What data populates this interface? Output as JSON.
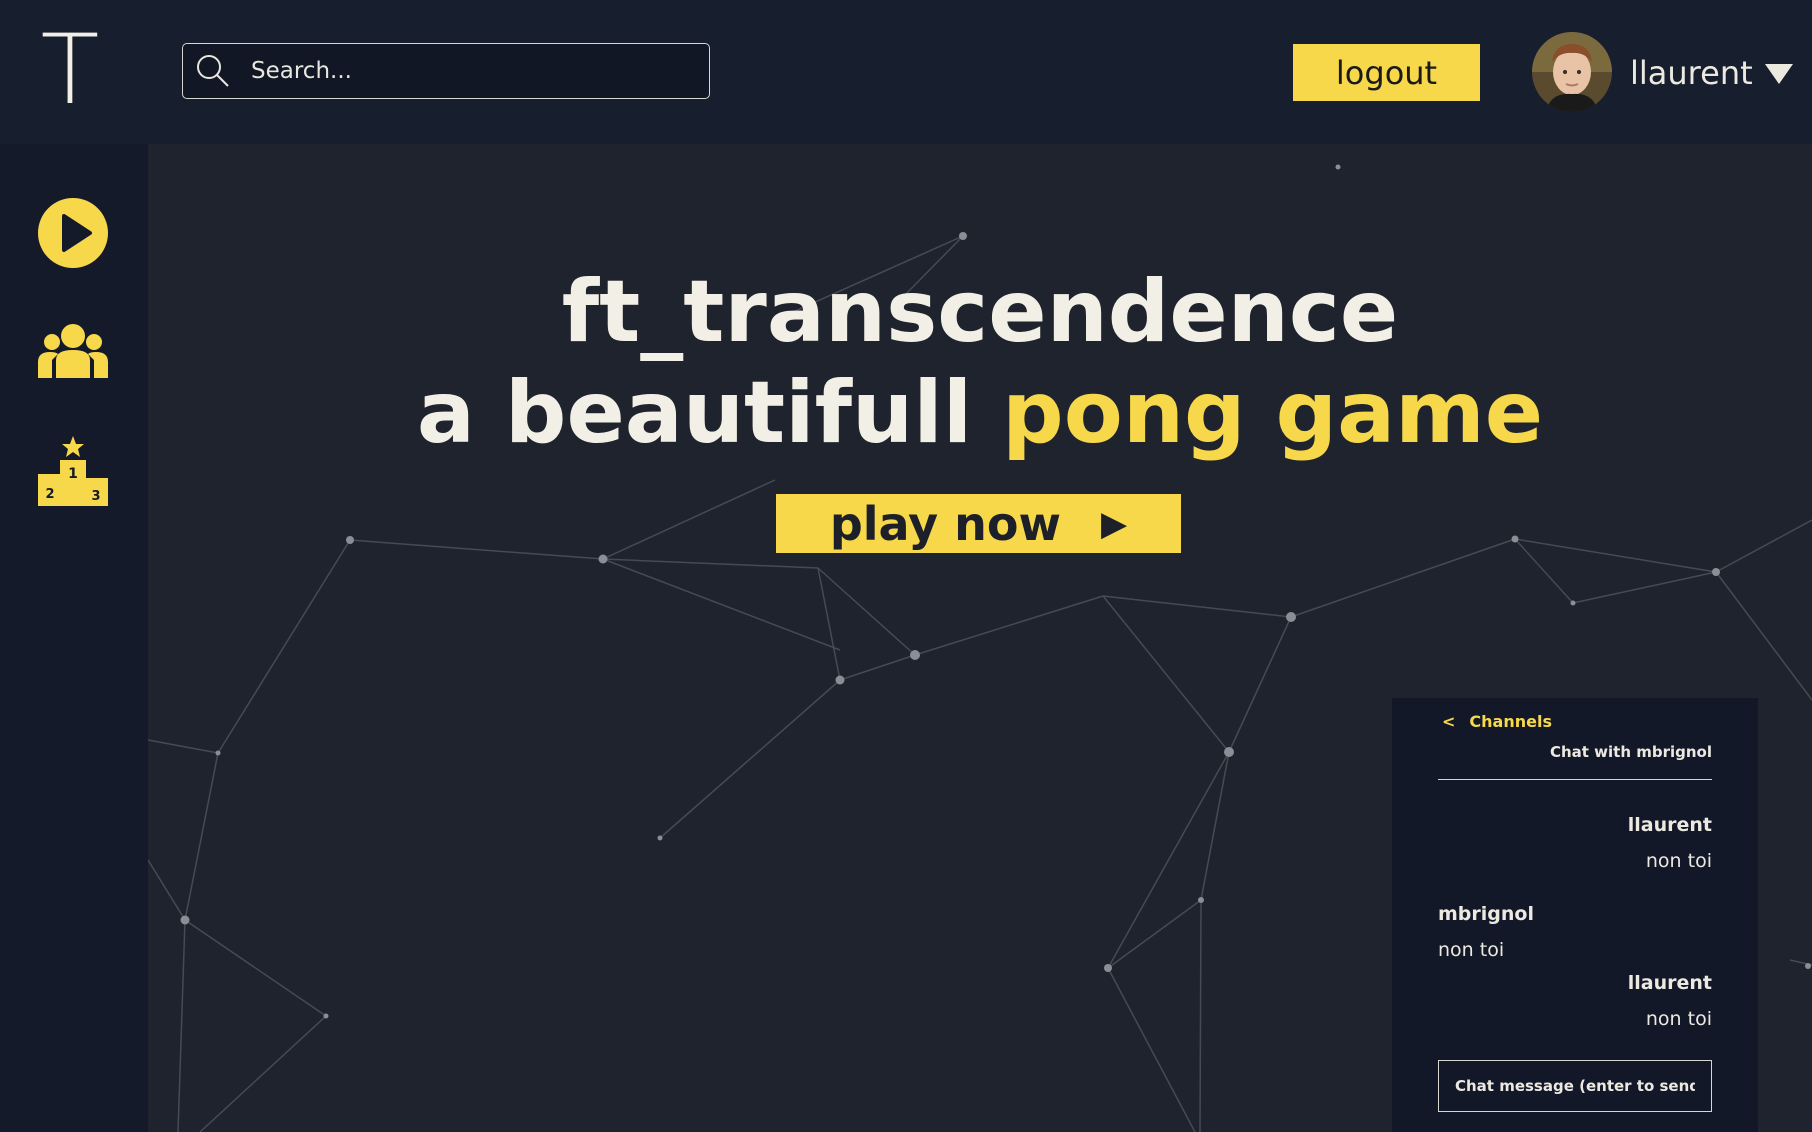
{
  "header": {
    "logo_letter": "T",
    "search": {
      "placeholder": "Search..."
    },
    "logout_label": "logout",
    "username": "llaurent"
  },
  "sidebar": {
    "items": [
      {
        "name": "play",
        "icon": "play-circle-icon"
      },
      {
        "name": "friends",
        "icon": "group-icon"
      },
      {
        "name": "leaderboard",
        "icon": "podium-icon"
      }
    ]
  },
  "hero": {
    "title_line1": "ft_transcendence",
    "title_line2_prefix": "a beautifull ",
    "title_line2_accent": "pong game",
    "play_label": "play now",
    "play_arrow": "▶"
  },
  "chat": {
    "back_chevron": "<",
    "back_label": "Channels",
    "title": "Chat with mbrignol",
    "messages": [
      {
        "author": "llaurent",
        "text": "non toi",
        "side": "right"
      },
      {
        "author": "mbrignol",
        "text": "non toi",
        "side": "left"
      },
      {
        "author": "llaurent",
        "text": "non toi",
        "side": "right"
      }
    ],
    "input_placeholder": "Chat message (enter to send)"
  },
  "colors": {
    "accent": "#f7d84b",
    "background": "#1e232d",
    "header": "#171e2d",
    "sidebar": "#141a29",
    "text": "#f2efe6"
  }
}
